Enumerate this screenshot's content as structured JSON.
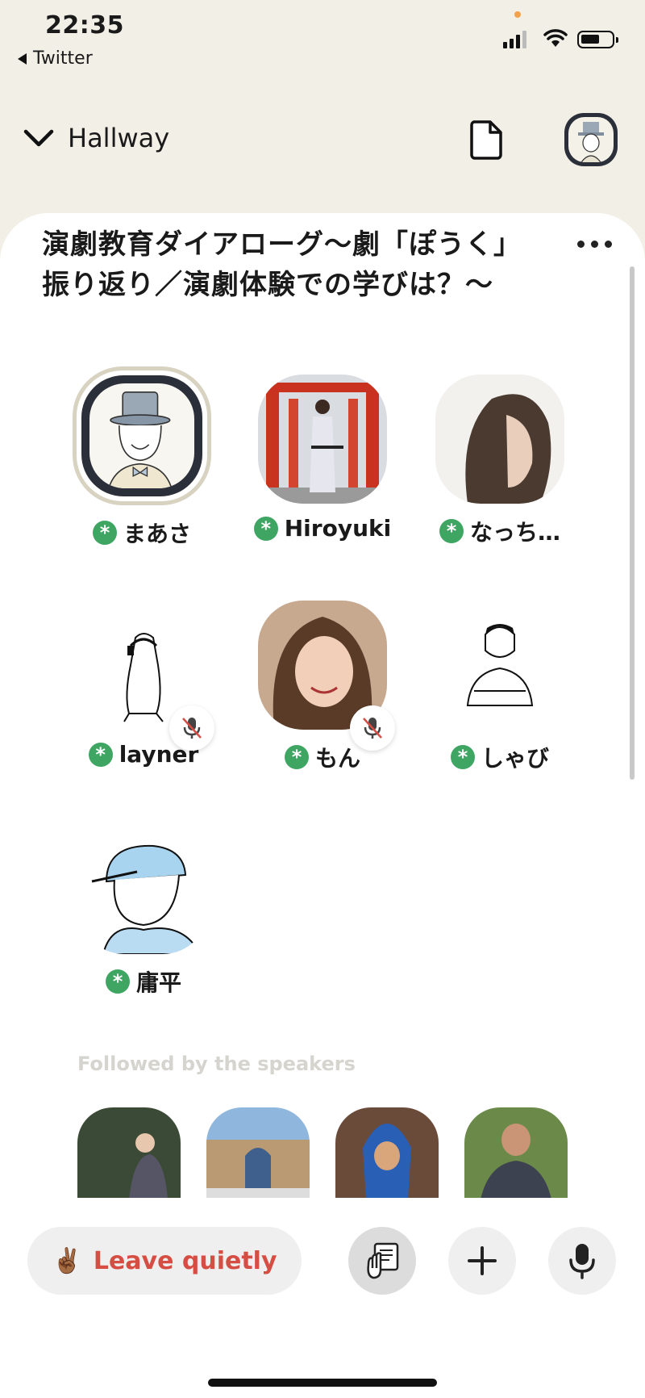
{
  "status_bar": {
    "time": "22:35",
    "back_app": "Twitter"
  },
  "header": {
    "section": "Hallway",
    "icons": [
      "chevron-down-icon",
      "document-icon",
      "profile-avatar"
    ]
  },
  "room": {
    "title": "演劇教育ダイアローグ〜劇「ぽうく」振り返り／演劇体験での学びは？〜",
    "speakers": [
      {
        "name": "まあさ",
        "moderator": true,
        "muted": false,
        "active": true
      },
      {
        "name": "Hiroyuki",
        "moderator": true,
        "muted": false
      },
      {
        "name": "なっち…",
        "moderator": true,
        "muted": false
      },
      {
        "name": "layner",
        "moderator": true,
        "muted": true
      },
      {
        "name": "もん",
        "moderator": true,
        "muted": true
      },
      {
        "name": "しゃび",
        "moderator": true,
        "muted": false
      },
      {
        "name": "庸平",
        "moderator": true,
        "muted": false
      }
    ],
    "followed_label": "Followed by the speakers"
  },
  "bottom": {
    "leave_label": "Leave quietly",
    "leave_emoji": "✌🏾",
    "buttons": [
      "raise-hand-icon",
      "plus-icon",
      "microphone-icon"
    ]
  },
  "colors": {
    "accent_red": "#d64e43",
    "moderator_green": "#3fa563",
    "background": "#f1efe6"
  }
}
